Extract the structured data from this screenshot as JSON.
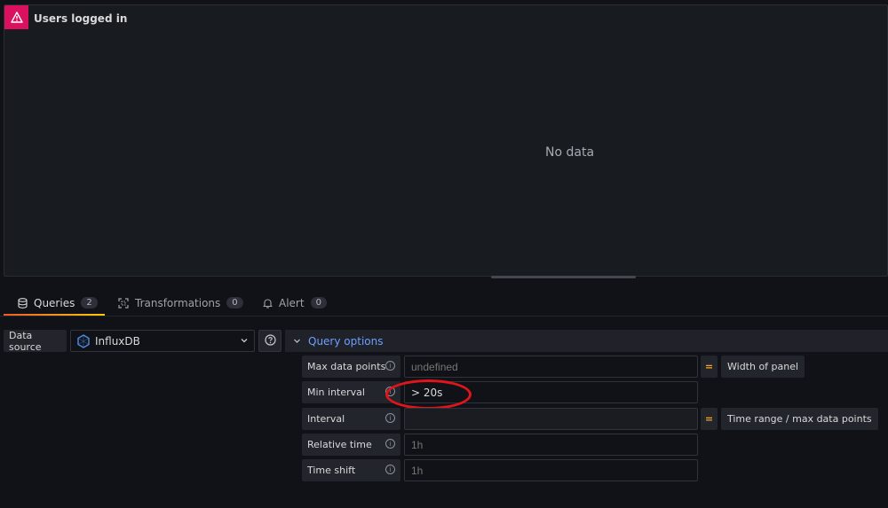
{
  "panel": {
    "title": "Users logged in",
    "empty_message": "No data",
    "status_icon": "warning-triangle-icon",
    "status_color": "#d9115f"
  },
  "tabs": [
    {
      "label": "Queries",
      "count": "2",
      "icon": "database-icon",
      "active": true
    },
    {
      "label": "Transformations",
      "count": "0",
      "icon": "transform-icon",
      "active": false
    },
    {
      "label": "Alert",
      "count": "0",
      "icon": "bell-icon",
      "active": false
    }
  ],
  "datasource": {
    "label": "Data source",
    "selected": "InfluxDB",
    "icon": "influxdb-logo-icon"
  },
  "query_options": {
    "title": "Query options",
    "rows": [
      {
        "label": "Max data points",
        "value": "",
        "placeholder": "undefined",
        "hint": "Width of panel"
      },
      {
        "label": "Min interval",
        "value": "> 20s",
        "placeholder": "",
        "hint": ""
      },
      {
        "label": "Interval",
        "value": "",
        "placeholder": "",
        "hint": "Time range / max data points"
      },
      {
        "label": "Relative time",
        "value": "",
        "placeholder": "1h",
        "hint": ""
      },
      {
        "label": "Time shift",
        "value": "",
        "placeholder": "1h",
        "hint": ""
      }
    ]
  },
  "colors": {
    "accent_link": "#6e9fff",
    "tab_underline_start": "#f05a28",
    "tab_underline_end": "#fbca0a",
    "annotation": "#e0151b"
  }
}
